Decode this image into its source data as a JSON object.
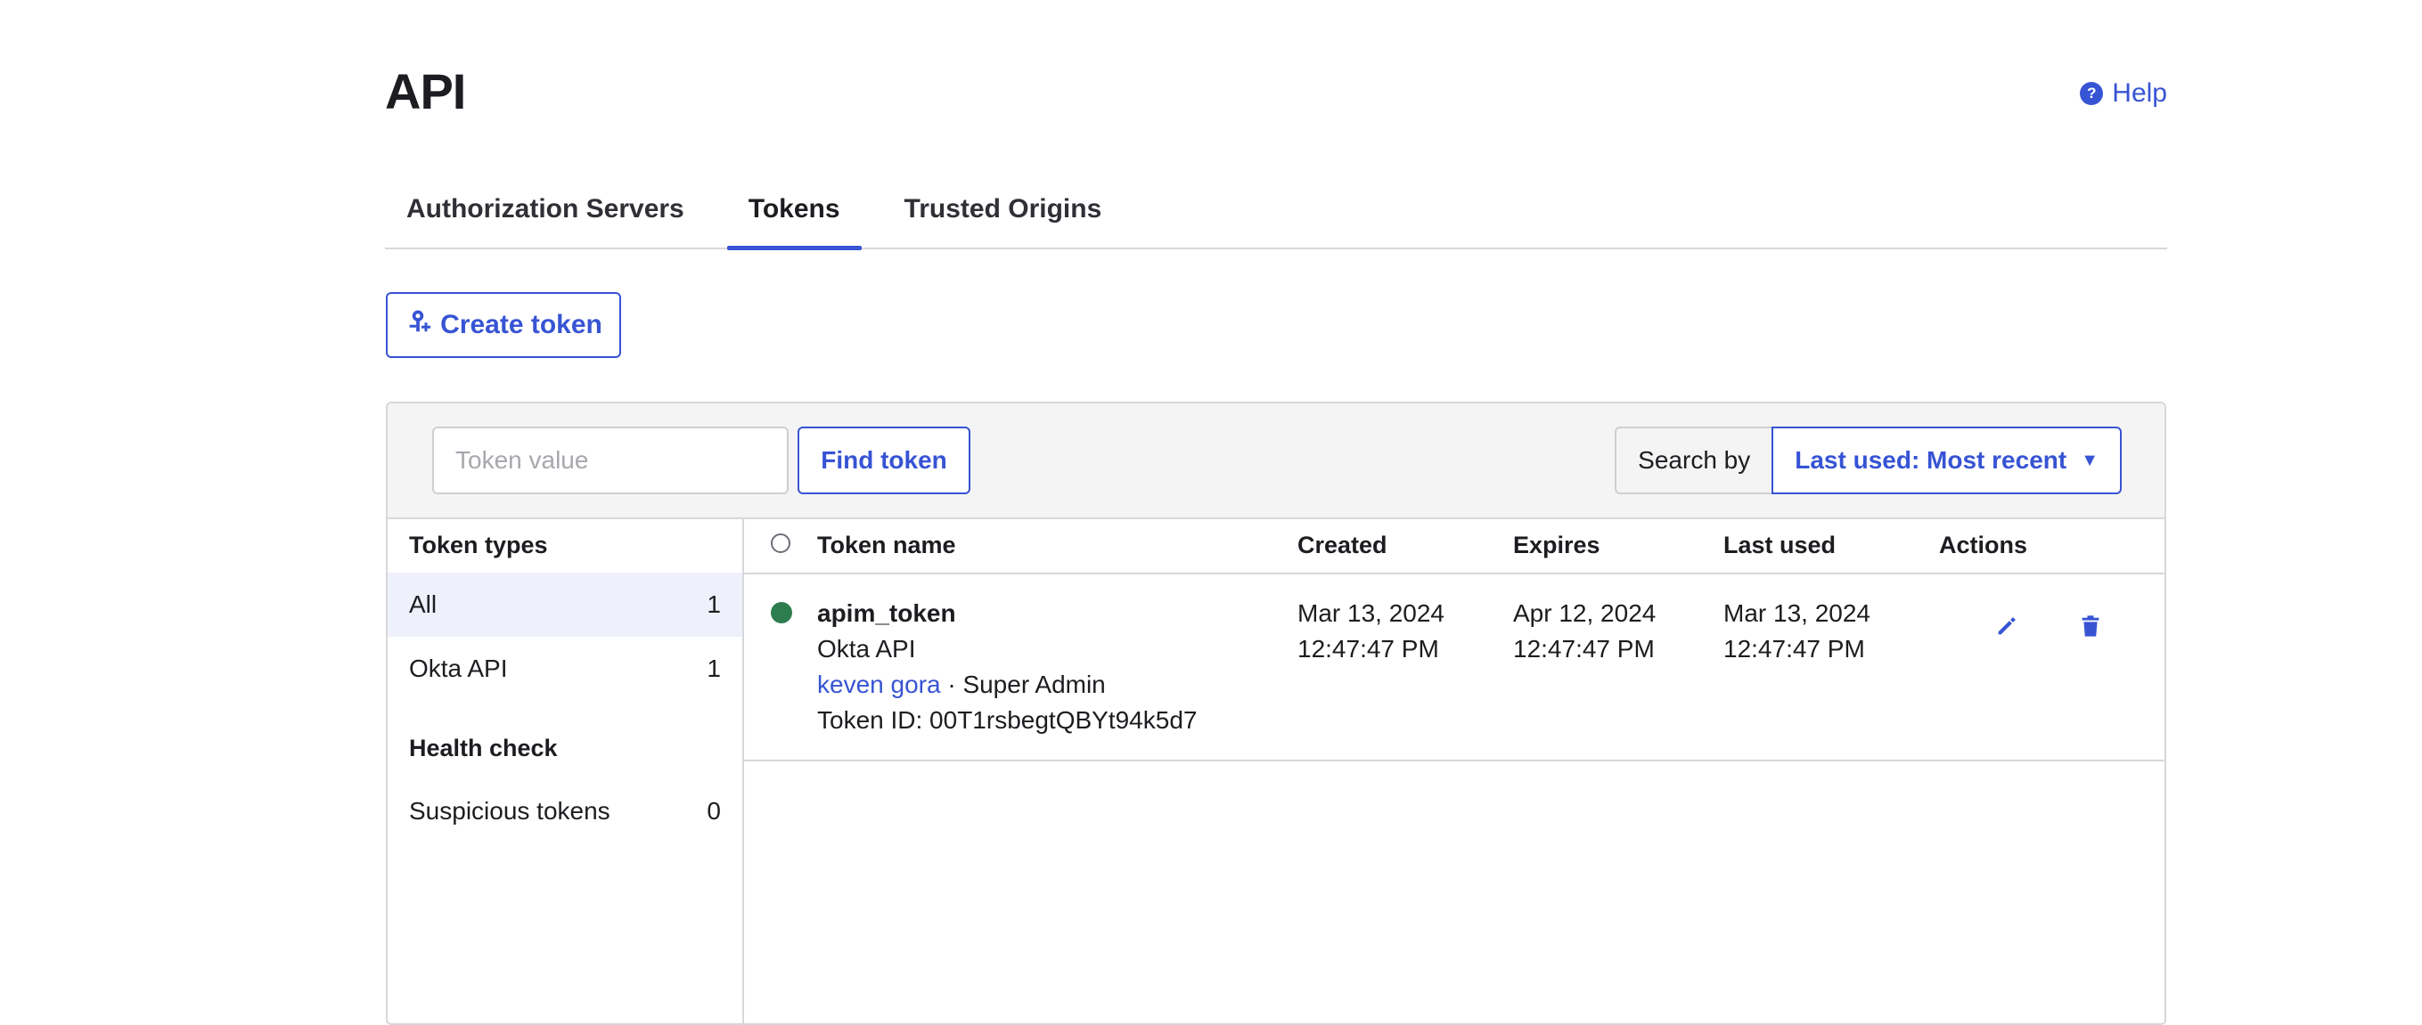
{
  "page": {
    "title": "API",
    "help_label": "Help"
  },
  "tabs": [
    {
      "label": "Authorization Servers",
      "active": false
    },
    {
      "label": "Tokens",
      "active": true
    },
    {
      "label": "Trusted Origins",
      "active": false
    }
  ],
  "create_button": {
    "label": "Create token",
    "icon": "key-plus-icon"
  },
  "toolbar": {
    "search_placeholder": "Token value",
    "search_value": "",
    "find_label": "Find token",
    "search_by_label": "Search by",
    "sort_value": "Last used: Most recent"
  },
  "sidebar": {
    "types_heading": "Token types",
    "types": [
      {
        "label": "All",
        "count": "1",
        "selected": true
      },
      {
        "label": "Okta API",
        "count": "1",
        "selected": false
      }
    ],
    "health_heading": "Health check",
    "health": [
      {
        "label": "Suspicious tokens",
        "count": "0"
      }
    ]
  },
  "table": {
    "headers": {
      "name": "Token name",
      "created": "Created",
      "expires": "Expires",
      "last_used": "Last used",
      "actions": "Actions"
    },
    "rows": [
      {
        "status": "active",
        "status_color": "#2e7d4f",
        "name": "apim_token",
        "type": "Okta API",
        "owner": "keven gora",
        "owner_sep": " · ",
        "role": "Super Admin",
        "token_id": "Token ID: 00T1rsbegtQBYt94k5d7",
        "created_date": "Mar 13, 2024",
        "created_time": "12:47:47 PM",
        "expires_date": "Apr 12, 2024",
        "expires_time": "12:47:47 PM",
        "last_used_date": "Mar 13, 2024",
        "last_used_time": "12:47:47 PM"
      }
    ]
  },
  "colors": {
    "accent": "#3754d4",
    "status_active": "#2e7d4f",
    "border": "#d7d7dc",
    "toolbar_bg": "#f4f4f4"
  }
}
